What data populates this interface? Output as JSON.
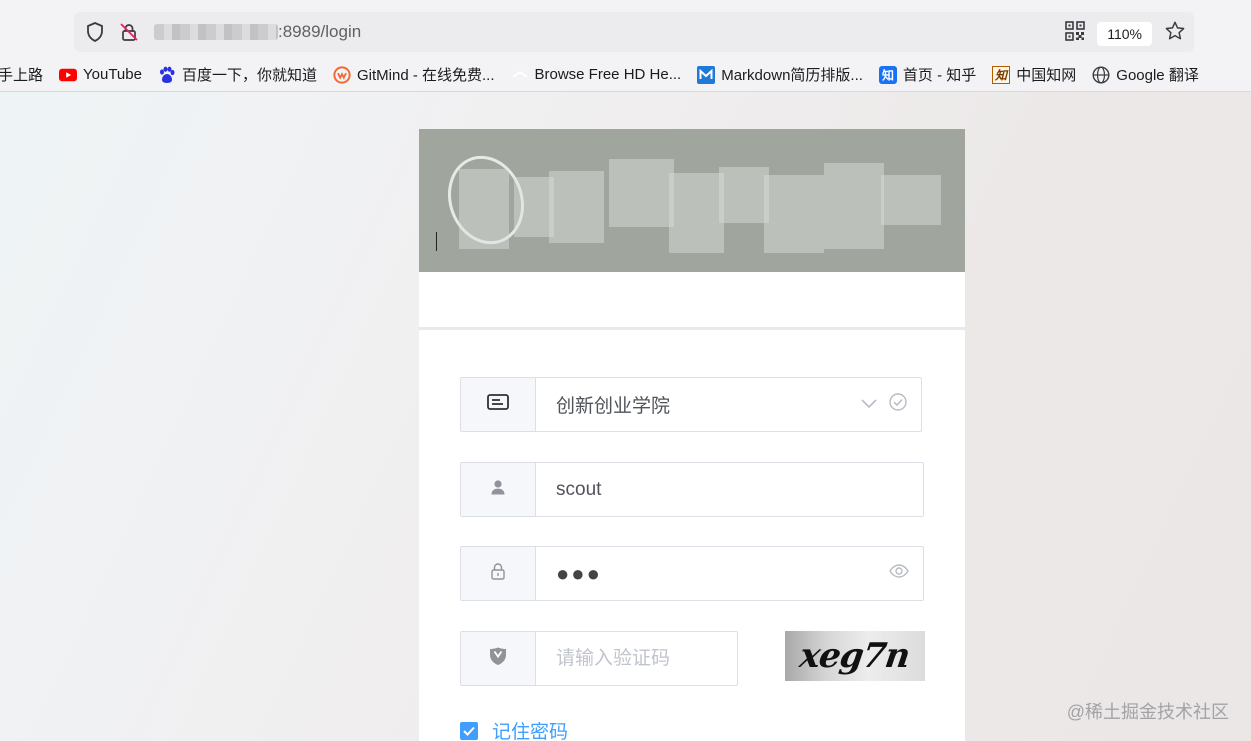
{
  "browser": {
    "url_suffix": ":8989/login",
    "zoom": "110%",
    "bookmarks": [
      {
        "label": "手上路",
        "icon": "none"
      },
      {
        "label": "YouTube",
        "icon": "youtube-icon"
      },
      {
        "label": "百度一下，你就知道",
        "icon": "baidu-icon"
      },
      {
        "label": "GitMind - 在线免费...",
        "icon": "gitmind-icon"
      },
      {
        "label": "Browse Free HD He...",
        "icon": "browse-icon"
      },
      {
        "label": "Markdown简历排版...",
        "icon": "markdown-icon"
      },
      {
        "label": "首页 - 知乎",
        "icon": "zhihu-icon"
      },
      {
        "label": "中国知网",
        "icon": "cnki-icon"
      },
      {
        "label": "Google 翻译",
        "icon": "globe-icon"
      }
    ]
  },
  "login": {
    "school_select": "创新创业学院",
    "username": "scout",
    "password_mask": "●●●",
    "captcha_placeholder": "请输入验证码",
    "captcha_text": "xeg7n",
    "remember_label": "记住密码"
  },
  "watermark": "@稀土掘金技术社区",
  "colors": {
    "accent": "#409eff",
    "banner": "#a0a69e",
    "prefix_bg": "#f5f7fa",
    "border": "#dcdfe6"
  }
}
